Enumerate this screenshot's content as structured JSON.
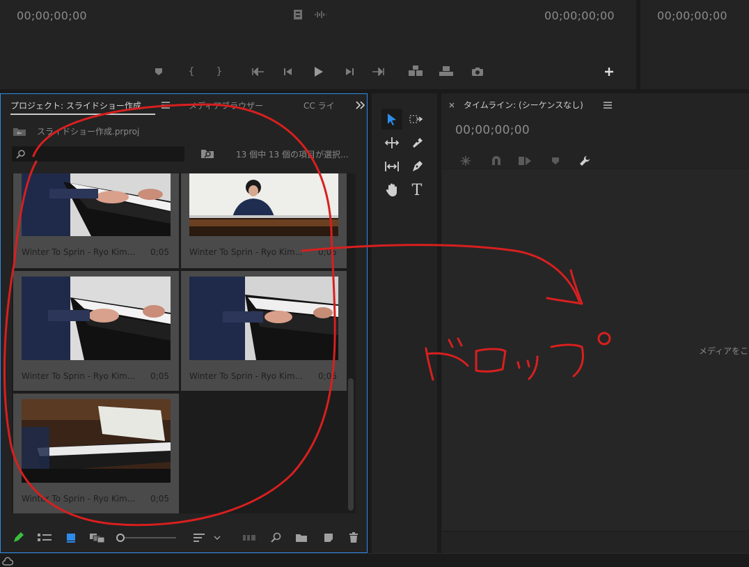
{
  "source_monitor": {
    "timecode_left": "00;00;00;00",
    "timecode_right": "00;00;00;00",
    "transport_icons": [
      "marker-icon",
      "mark-in-icon",
      "mark-out-icon",
      "go-to-in-icon",
      "step-back-icon",
      "play-icon",
      "step-forward-icon",
      "go-to-out-icon",
      "insert-icon",
      "overwrite-icon",
      "export-frame-icon",
      "add-icon"
    ]
  },
  "program_monitor": {
    "timecode": "00;00;00;00"
  },
  "project_panel": {
    "tabs": [
      {
        "label": "プロジェクト: スライドショー作成",
        "active": true
      },
      {
        "label": "メディアブラウザー",
        "active": false
      },
      {
        "label": "CC ライ",
        "active": false
      }
    ],
    "file_name": "スライドショー作成.prproj",
    "search_placeholder": "",
    "selection_status": "13 個中 13 個の項目が選択...",
    "clips": [
      {
        "name": "Winter To Sprin - Ryo Kim...",
        "duration": "0;05"
      },
      {
        "name": "Winter To Sprin - Ryo Kim...",
        "duration": "0;05"
      },
      {
        "name": "Winter To Sprin - Ryo Kim...",
        "duration": "0;05"
      },
      {
        "name": "Winter To Sprin - Ryo Kim...",
        "duration": "0;05"
      },
      {
        "name": "Winter To Sprin - Ryo Kim...",
        "duration": "0;05"
      }
    ]
  },
  "timeline_panel": {
    "title": "タイムライン: (シーケンスなし)",
    "timecode": "00;00;00;00",
    "empty_message": "メディアをこ"
  },
  "annotation": {
    "handwritten_text": "ドロップ",
    "color": "#d81f1f"
  },
  "colors": {
    "accent_blue": "#2d8ceb",
    "panel_bg": "#232323",
    "card_bg": "#4a4a4a",
    "pencil_green": "#3bbf3b"
  }
}
